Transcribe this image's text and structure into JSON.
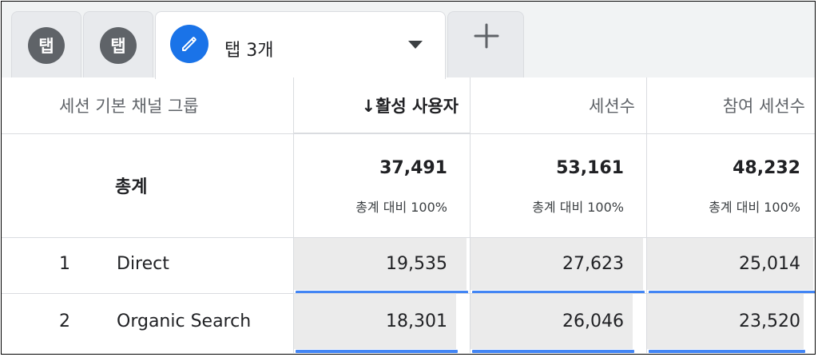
{
  "tabs": [
    {
      "label": "탭",
      "active": false
    },
    {
      "label": "탭",
      "active": false
    },
    {
      "label": "탭 3개",
      "active": true
    }
  ],
  "colors": {
    "accent": "#1a73e8",
    "bar": "#4285f4",
    "cell_fill": "#ebebeb"
  },
  "icons": {
    "edit": "pencil-icon",
    "dropdown": "caret-down-icon",
    "add": "plus-icon"
  },
  "table": {
    "columns": [
      "세션 기본 채널 그룹",
      "↓활성 사용자",
      "세션수",
      "참여 세션수"
    ],
    "sorted_column": 1,
    "totals": {
      "label": "총계",
      "values": [
        "37,491",
        "53,161",
        "48,232"
      ],
      "pct": [
        "총계 대비 100%",
        "총계 대비 100%",
        "총계 대비 100%"
      ]
    },
    "rows": [
      {
        "rank": "1",
        "channel": "Direct",
        "values": [
          "19,535",
          "27,623",
          "25,014"
        ],
        "share": [
          1.0,
          1.0,
          1.0
        ]
      },
      {
        "rank": "2",
        "channel": "Organic Search",
        "values": [
          "18,301",
          "26,046",
          "23,520"
        ],
        "share": [
          0.94,
          0.94,
          0.94
        ]
      }
    ]
  }
}
